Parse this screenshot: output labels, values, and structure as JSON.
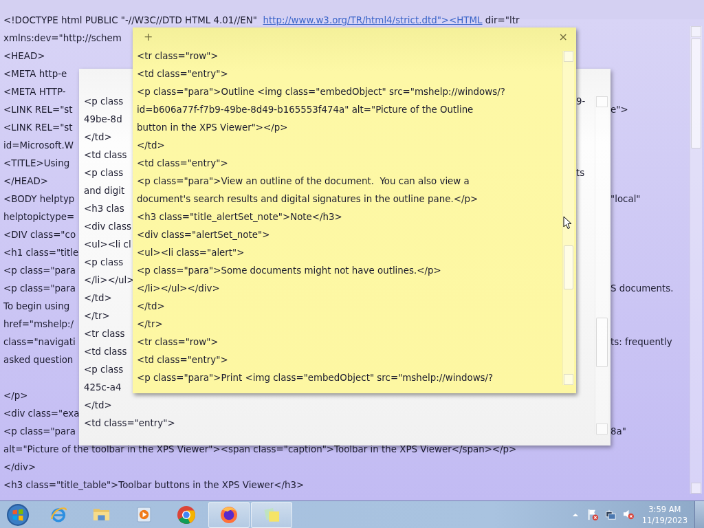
{
  "background_note": {
    "lines": [
      {
        "text": "<!DOCTYPE html PUBLIC \"-//W3C//DTD HTML 4.01//EN\"",
        "link": "http://www.w3.org/TR/html4/strict.dtd\"><HTML",
        "tail": "dir=\"ltr"
      },
      {
        "text": "xmlns:dev=\"http://schem"
      },
      {
        "text": "<HEAD>"
      },
      {
        "text": "<META http-e"
      },
      {
        "text": "<META HTTP-"
      },
      {
        "text": "<LINK REL=\"st",
        "right": "e\">"
      },
      {
        "text": "<LINK REL=\"st"
      },
      {
        "text": "id=Microsoft.W"
      },
      {
        "text": "<TITLE>Using"
      },
      {
        "text": "</HEAD>"
      },
      {
        "text": "<BODY helptyp",
        "right": "\"local\""
      },
      {
        "text": "helptopictype="
      },
      {
        "text": "<DIV class=\"co"
      },
      {
        "text": "<h1 class=\"title"
      },
      {
        "text": "<p class=\"para"
      },
      {
        "text": "<p class=\"para",
        "right": "S documents."
      },
      {
        "text": "To begin using"
      },
      {
        "text": "href=\"mshelp:/"
      },
      {
        "text": "class=\"navigati",
        "right": "ts: frequently"
      },
      {
        "text": "asked question"
      },
      {
        "text": "</p>",
        "gap_before": true
      },
      {
        "text": "<div class=\"exa"
      },
      {
        "text": "<p class=\"para",
        "right": "8a\""
      },
      {
        "text": "alt=\"Picture of the toolbar in the XPS Viewer\"><span class=\"caption\">Toolbar in the XPS Viewer</span></p>"
      },
      {
        "text": "</div>"
      },
      {
        "text": "<h3 class=\"title_table\">Toolbar buttons in the XPS Viewer</h3>"
      }
    ]
  },
  "white_note": {
    "lines": [
      {
        "text": "<p class",
        "right": "9-"
      },
      {
        "text": "49be-8d"
      },
      {
        "text": "</td>"
      },
      {
        "text": "<td class"
      },
      {
        "text": "<p class",
        "right": "ts"
      },
      {
        "text": "and digit"
      },
      {
        "text": "<h3 clas"
      },
      {
        "text": "<div class"
      },
      {
        "text": "<ul><li cl"
      },
      {
        "text": "<p class"
      },
      {
        "text": "</li></ul>"
      },
      {
        "text": "</td>"
      },
      {
        "text": "</tr>"
      },
      {
        "text": "<tr class"
      },
      {
        "text": "<td class"
      },
      {
        "text": "<p class"
      },
      {
        "text": "425c-a4"
      },
      {
        "text": "</td>"
      },
      {
        "text": "<td class=\"entry\">"
      }
    ]
  },
  "yellow_note": {
    "add_button": "+",
    "close_button": "×",
    "lines": [
      "<tr class=\"row\">",
      "<td class=\"entry\">",
      "<p class=\"para\">Outline <img class=\"embedObject\" src=\"mshelp://windows/?",
      "id=b606a77f-f7b9-49be-8d49-b165553f474a\" alt=\"Picture of the Outline",
      "button in the XPS Viewer\"></p>",
      "</td>",
      "<td class=\"entry\">",
      "<p class=\"para\">View an outline of the document.  You can also view a",
      "document's search results and digital signatures in the outline pane.</p>",
      "<h3 class=\"title_alertSet_note\">Note</h3>",
      "<div class=\"alertSet_note\">",
      "<ul><li class=\"alert\">",
      "<p class=\"para\">Some documents might not have outlines.</p>",
      "</li></ul></div>",
      "</td>",
      "</tr>",
      "<tr class=\"row\">",
      "<td class=\"entry\">",
      "<p class=\"para\">Print <img class=\"embedObject\" src=\"mshelp://windows/?"
    ]
  },
  "taskbar": {
    "apps": [
      {
        "kind": "start",
        "active": false
      },
      {
        "kind": "browser_e",
        "active": false
      },
      {
        "kind": "folder",
        "active": false
      },
      {
        "kind": "media",
        "active": false
      },
      {
        "kind": "chrome",
        "active": false
      },
      {
        "kind": "firefox",
        "active": true
      },
      {
        "kind": "notes",
        "active": true
      }
    ],
    "tray": [
      {
        "kind": "overflow"
      },
      {
        "kind": "flag"
      },
      {
        "kind": "network"
      },
      {
        "kind": "volume"
      }
    ],
    "clock": {
      "time": "3:59 AM",
      "date": "11/19/2023"
    }
  }
}
